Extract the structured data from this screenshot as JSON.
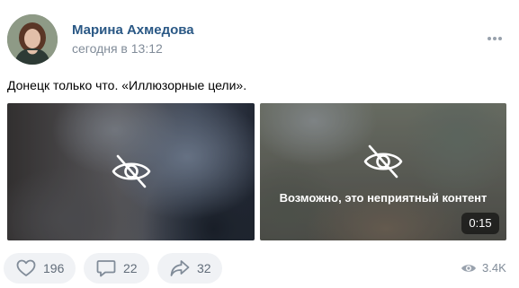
{
  "post": {
    "author": "Марина Ахмедова",
    "timestamp": "сегодня в 13:12",
    "text": "Донецк только что. «Иллюзорные цели».",
    "more_icon": "more-dots-icon"
  },
  "media": [
    {
      "type": "photo",
      "hidden_icon": "eye-crossed-icon"
    },
    {
      "type": "video",
      "hidden_icon": "eye-crossed-icon",
      "warning": "Возможно, это неприятный контент",
      "duration": "0:15"
    }
  ],
  "actions": {
    "likes": {
      "icon": "heart-icon",
      "count": "196"
    },
    "comments": {
      "icon": "comment-icon",
      "count": "22"
    },
    "shares": {
      "icon": "share-icon",
      "count": "32"
    },
    "views": {
      "icon": "eye-icon",
      "count": "3.4K"
    }
  },
  "colors": {
    "author": "#2a5885",
    "secondary_text": "#818c99",
    "action_bg": "#f0f2f5",
    "action_text": "#626d7a"
  }
}
